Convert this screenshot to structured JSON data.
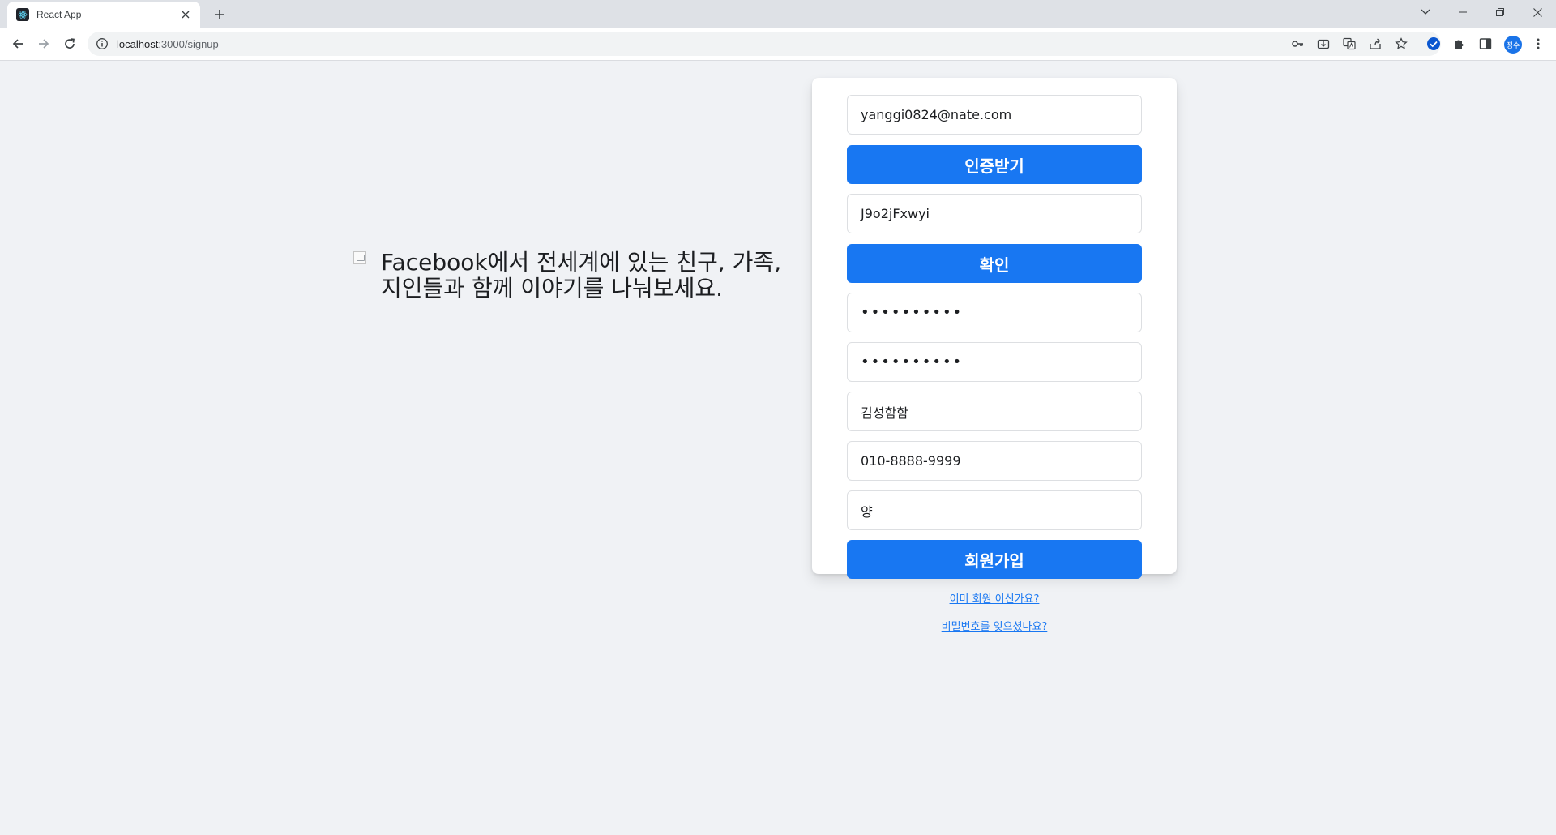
{
  "browser": {
    "tab_title": "React App",
    "url_host": "localhost",
    "url_path": ":3000/signup",
    "profile_initials": "정수"
  },
  "hero": {
    "text": "Facebook에서 전세계에 있는 친구, 가족, 지인들과 함께 이야기를 나눠보세요."
  },
  "form": {
    "email_value": "yanggi0824@nate.com",
    "verify_request_label": "인증받기",
    "code_value": "J9o2jFxwyi",
    "confirm_label": "확인",
    "password_value": "••••••••••",
    "password_confirm_value": "••••••••••",
    "name_value": "김성함함",
    "phone_value": "010-8888-9999",
    "nickname_value": "양",
    "signup_label": "회원가입",
    "login_link": "이미 회원 이신가요?",
    "forgot_link": "비밀번호를 잊으셨나요?"
  },
  "colors": {
    "primary": "#1877f2",
    "page_bg": "#f0f2f5"
  }
}
